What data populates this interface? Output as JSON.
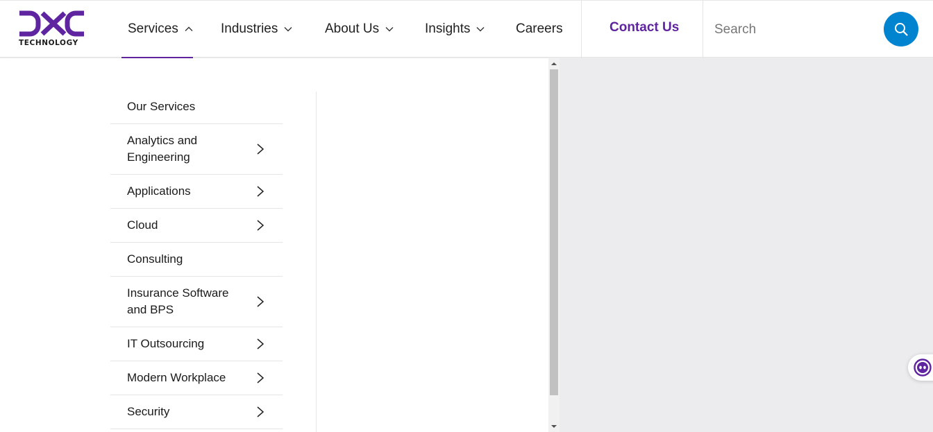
{
  "header": {
    "logo_text": "TECHNOLOGY",
    "nav": [
      {
        "label": "Services",
        "state": "expanded"
      },
      {
        "label": "Industries",
        "state": "collapsed"
      },
      {
        "label": "About Us",
        "state": "collapsed"
      },
      {
        "label": "Insights",
        "state": "collapsed"
      },
      {
        "label": "Careers"
      }
    ],
    "contact_label": "Contact Us",
    "search": {
      "placeholder": "Search",
      "value": ""
    }
  },
  "services_menu": {
    "items": [
      {
        "label": "Our Services",
        "has_submenu": false
      },
      {
        "label": "Analytics and Engineering",
        "has_submenu": true
      },
      {
        "label": "Applications",
        "has_submenu": true
      },
      {
        "label": "Cloud",
        "has_submenu": true
      },
      {
        "label": "Consulting",
        "has_submenu": false
      },
      {
        "label": "Insurance Software and BPS",
        "has_submenu": true
      },
      {
        "label": "IT Outsourcing",
        "has_submenu": true
      },
      {
        "label": "Modern Workplace",
        "has_submenu": true
      },
      {
        "label": "Security",
        "has_submenu": true
      }
    ]
  },
  "icons": {
    "nav_chevron_up": "chevron-up-icon",
    "nav_chevron_down": "chevron-down-icon",
    "menu_arrow": "chevron-right-icon",
    "search": "search-icon",
    "chat": "chat-bot-icon"
  },
  "colors": {
    "brand_purple": "#5f249f",
    "search_button": "#0084cf",
    "page_background": "#ececef"
  }
}
